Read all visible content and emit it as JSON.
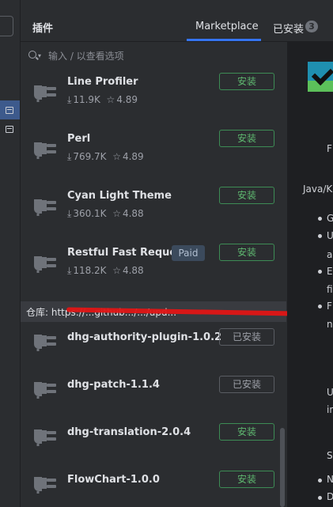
{
  "header": {
    "title": "插件",
    "tabs": [
      {
        "label": "Marketplace",
        "active": true
      },
      {
        "label": "已安装",
        "badge": "3"
      }
    ]
  },
  "search": {
    "placeholder": "输入 / 以查看选项"
  },
  "plugins": [
    {
      "name": "Line Profiler",
      "downloads": "11.9K",
      "rating": "4.89",
      "button": "安装"
    },
    {
      "name": "Perl",
      "downloads": "769.7K",
      "rating": "4.89",
      "button": "安装"
    },
    {
      "name": "Cyan Light Theme",
      "downloads": "360.1K",
      "rating": "4.88",
      "button": "安装"
    },
    {
      "name": "Restful Fast Reque...",
      "downloads": "118.2K",
      "rating": "4.88",
      "button": "安装",
      "tag": "Paid"
    }
  ],
  "repo": {
    "label": "仓库: https://...github.../.../upd..."
  },
  "repo_plugins": [
    {
      "name": "dhg-authority-plugin-1.0.2",
      "button": "已安装"
    },
    {
      "name": "dhg-patch-1.1.4",
      "button": "已安装"
    },
    {
      "name": "dhg-translation-2.0.4",
      "button": "安装"
    },
    {
      "name": "FlowChart-1.0.0",
      "button": "安装"
    }
  ],
  "details": {
    "lines": [
      "F",
      "Java/K",
      "G",
      "U",
      "a",
      "E",
      "fi",
      "F",
      "n",
      "U",
      "in",
      "S",
      "N",
      "D"
    ]
  },
  "colors": {
    "accent": "#3574f0",
    "install_green": "#5fb870",
    "annotation_red": "#e01515"
  }
}
